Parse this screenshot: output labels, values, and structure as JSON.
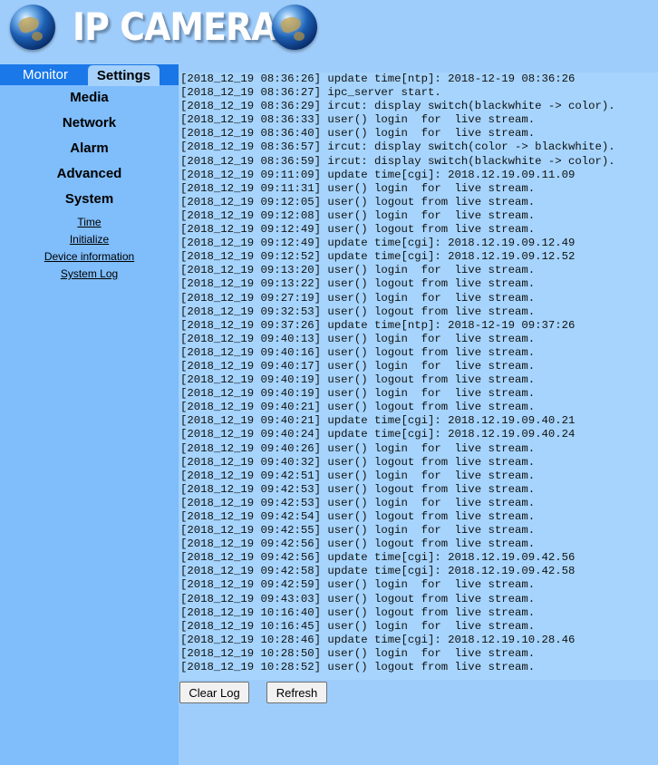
{
  "header": {
    "title": "IP CAMERA"
  },
  "tabs": {
    "monitor": "Monitor",
    "settings": "Settings"
  },
  "menu": {
    "items": [
      "Media",
      "Network",
      "Alarm",
      "Advanced",
      "System"
    ],
    "system_subitems": [
      "Time",
      "Initialize",
      "Device information",
      "System Log"
    ]
  },
  "log_lines": [
    "[2018_12_19 08:36:26] update time[ntp]: 2018-12-19 08:36:26",
    "[2018_12_19 08:36:27] ipc_server start.",
    "[2018_12_19 08:36:29] ircut: display switch(blackwhite -> color).",
    "[2018_12_19 08:36:33] user() login  for  live stream.",
    "[2018_12_19 08:36:40] user() login  for  live stream.",
    "[2018_12_19 08:36:57] ircut: display switch(color -> blackwhite).",
    "[2018_12_19 08:36:59] ircut: display switch(blackwhite -> color).",
    "[2018_12_19 09:11:09] update time[cgi]: 2018.12.19.09.11.09",
    "[2018_12_19 09:11:31] user() login  for  live stream.",
    "[2018_12_19 09:12:05] user() logout from live stream.",
    "[2018_12_19 09:12:08] user() login  for  live stream.",
    "[2018_12_19 09:12:49] user() logout from live stream.",
    "[2018_12_19 09:12:49] update time[cgi]: 2018.12.19.09.12.49",
    "[2018_12_19 09:12:52] update time[cgi]: 2018.12.19.09.12.52",
    "[2018_12_19 09:13:20] user() login  for  live stream.",
    "[2018_12_19 09:13:22] user() logout from live stream.",
    "[2018_12_19 09:27:19] user() login  for  live stream.",
    "[2018_12_19 09:32:53] user() logout from live stream.",
    "[2018_12_19 09:37:26] update time[ntp]: 2018-12-19 09:37:26",
    "[2018_12_19 09:40:13] user() login  for  live stream.",
    "[2018_12_19 09:40:16] user() logout from live stream.",
    "[2018_12_19 09:40:17] user() login  for  live stream.",
    "[2018_12_19 09:40:19] user() logout from live stream.",
    "[2018_12_19 09:40:19] user() login  for  live stream.",
    "[2018_12_19 09:40:21] user() logout from live stream.",
    "[2018_12_19 09:40:21] update time[cgi]: 2018.12.19.09.40.21",
    "[2018_12_19 09:40:24] update time[cgi]: 2018.12.19.09.40.24",
    "[2018_12_19 09:40:26] user() login  for  live stream.",
    "[2018_12_19 09:40:32] user() logout from live stream.",
    "[2018_12_19 09:42:51] user() login  for  live stream.",
    "[2018_12_19 09:42:53] user() logout from live stream.",
    "[2018_12_19 09:42:53] user() login  for  live stream.",
    "[2018_12_19 09:42:54] user() logout from live stream.",
    "[2018_12_19 09:42:55] user() login  for  live stream.",
    "[2018_12_19 09:42:56] user() logout from live stream.",
    "[2018_12_19 09:42:56] update time[cgi]: 2018.12.19.09.42.56",
    "[2018_12_19 09:42:58] update time[cgi]: 2018.12.19.09.42.58",
    "[2018_12_19 09:42:59] user() login  for  live stream.",
    "[2018_12_19 09:43:03] user() logout from live stream.",
    "[2018_12_19 10:16:40] user() logout from live stream.",
    "[2018_12_19 10:16:45] user() login  for  live stream.",
    "[2018_12_19 10:28:46] update time[cgi]: 2018.12.19.10.28.46",
    "[2018_12_19 10:28:50] user() login  for  live stream.",
    "[2018_12_19 10:28:52] user() logout from live stream."
  ],
  "buttons": {
    "clear_log": "Clear Log",
    "refresh": "Refresh"
  }
}
